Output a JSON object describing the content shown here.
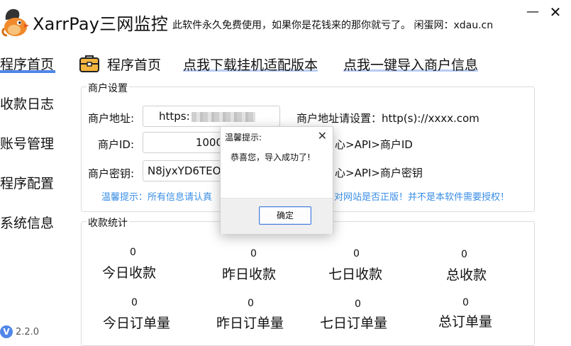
{
  "app": {
    "title": "XarrPay三网监控",
    "notice": "此软件永久免费使用，如果你是花钱来的那你就亏了。 闲蛋网：xdau.cn",
    "minimize_glyph": "—",
    "close_glyph": "✕",
    "logo_icon": "bird-logo-icon"
  },
  "sidebar": {
    "items": [
      {
        "label": "程序首页",
        "active": true
      },
      {
        "label": "收款日志"
      },
      {
        "label": "账号管理"
      },
      {
        "label": "程序配置"
      },
      {
        "label": "系统信息"
      }
    ],
    "version_badge": "V",
    "version": "2.2.0"
  },
  "tabs": {
    "home": "程序首页",
    "download": "点我下载挂机适配版本",
    "import": "点我一键导入商户信息"
  },
  "merchant": {
    "group_title": "商户设置",
    "address_label": "商户地址:",
    "address_value": "https:",
    "address_hint": "商户地址请设置：http(s)://xxxx.com",
    "id_label": "商户ID:",
    "id_value": "1000",
    "id_hint": "心>API>商户ID",
    "key_label": "商户密钥:",
    "key_value": "N8jyxYD6TEO",
    "key_hint": "心>API>商户密钥",
    "warm_tip_left": "温馨提示：所有信息请认真",
    "warm_tip_right": "对网站是否正版！并不是本软件需要授权！"
  },
  "stats": {
    "group_title": "收款统计",
    "items": [
      {
        "label": "今日收款",
        "value": "0"
      },
      {
        "label": "昨日收款",
        "value": "0"
      },
      {
        "label": "七日收款",
        "value": "0"
      },
      {
        "label": "总收款",
        "value": "0"
      },
      {
        "label": "今日订单量",
        "value": "0"
      },
      {
        "label": "昨日订单量",
        "value": "0"
      },
      {
        "label": "七日订单量",
        "value": "0"
      },
      {
        "label": "总订单量",
        "value": "0"
      }
    ]
  },
  "dialog": {
    "title": "温馨提示:",
    "message": "恭喜您，导入成功了!",
    "ok_label": "确定",
    "close_glyph": "✕"
  },
  "colors": {
    "accent": "#4f86e8",
    "hint": "#3a8ee6",
    "tab_underline": "#b9cdf3"
  }
}
